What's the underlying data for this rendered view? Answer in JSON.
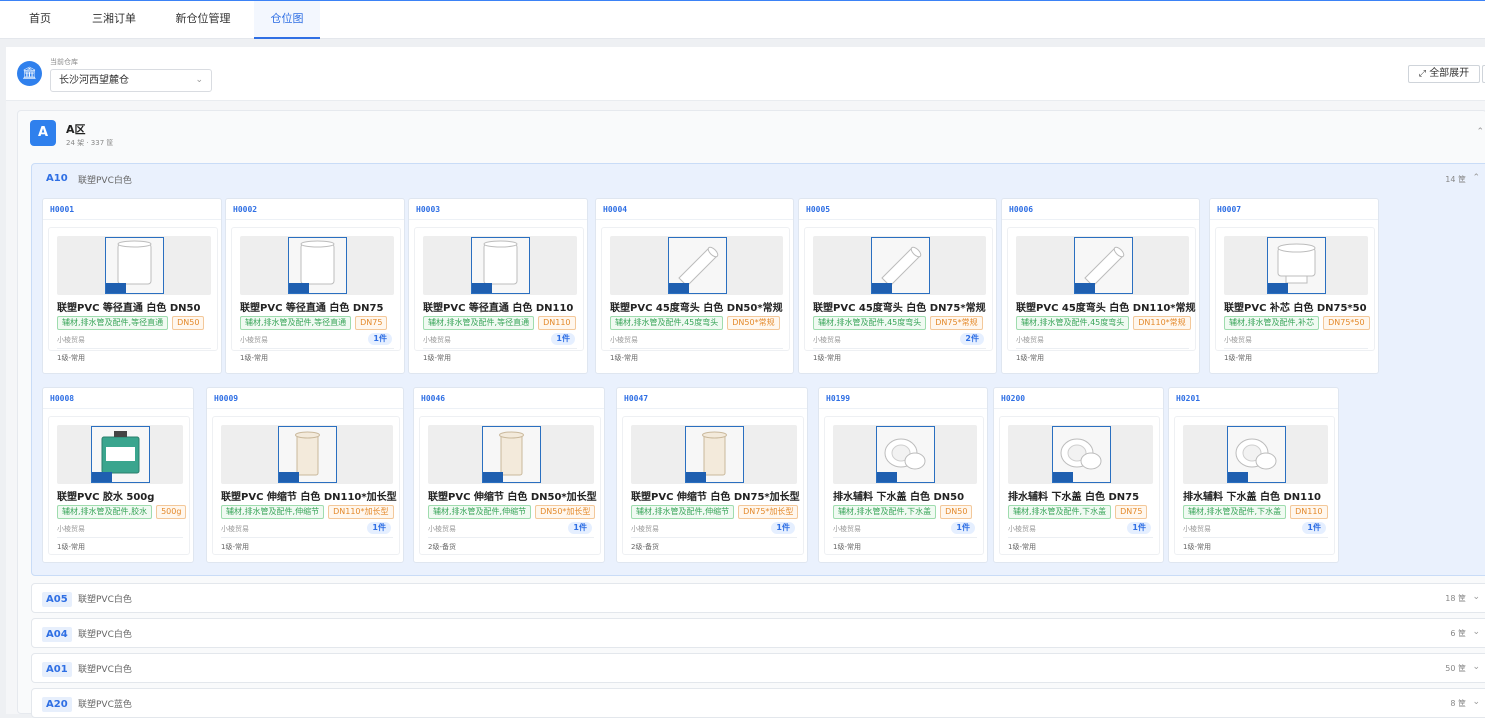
{
  "nav": {
    "tabs": [
      "首页",
      "三湘订单",
      "新仓位管理",
      "仓位图"
    ],
    "active_tab": 3
  },
  "warehouse": {
    "label": "当前仓库",
    "selected": "长沙河西望麓仓",
    "expand_all": "全部展开"
  },
  "zone": {
    "badge": "A",
    "title": "A区",
    "summary": "24 架 · 337 筐",
    "open_shelf": {
      "code": "A10",
      "name": "联塑PVC白色",
      "count": "14 筐"
    },
    "closed_shelves": [
      {
        "code": "A05",
        "name": "联塑PVC白色",
        "count": "18 筐"
      },
      {
        "code": "A04",
        "name": "联塑PVC白色",
        "count": "6 筐"
      },
      {
        "code": "A01",
        "name": "联塑PVC白色",
        "count": "50 筐"
      },
      {
        "code": "A20",
        "name": "联塑PVC蓝色",
        "count": "8 筐"
      }
    ]
  },
  "slots": [
    {
      "code": "H0001",
      "name": "联塑PVC 等径直通 白色 DN50",
      "category": "辅材,排水管及配件,等径直通",
      "spec": "DN50",
      "supplier": "小棱贸易",
      "qty": "",
      "level": "1级-常用",
      "icon": "pipe-coupling-icon"
    },
    {
      "code": "H0002",
      "name": "联塑PVC 等径直通 白色 DN75",
      "category": "辅材,排水管及配件,等径直通",
      "spec": "DN75",
      "supplier": "小棱贸易",
      "qty": "1件",
      "level": "1级-常用",
      "icon": "pipe-coupling-icon"
    },
    {
      "code": "H0003",
      "name": "联塑PVC 等径直通 白色 DN110",
      "category": "辅材,排水管及配件,等径直通",
      "spec": "DN110",
      "supplier": "小棱贸易",
      "qty": "1件",
      "level": "1级-常用",
      "icon": "pipe-coupling-icon"
    },
    {
      "code": "H0004",
      "name": "联塑PVC 45度弯头 白色 DN50*常规",
      "category": "辅材,排水管及配件,45度弯头",
      "spec": "DN50*常规",
      "supplier": "小棱贸易",
      "qty": "",
      "level": "1级-常用",
      "icon": "elbow-45-icon"
    },
    {
      "code": "H0005",
      "name": "联塑PVC 45度弯头 白色 DN75*常规",
      "category": "辅材,排水管及配件,45度弯头",
      "spec": "DN75*常规",
      "supplier": "小棱贸易",
      "qty": "2件",
      "level": "1级-常用",
      "icon": "elbow-45-icon"
    },
    {
      "code": "H0006",
      "name": "联塑PVC 45度弯头 白色 DN110*常规",
      "category": "辅材,排水管及配件,45度弯头",
      "spec": "DN110*常规",
      "supplier": "小棱贸易",
      "qty": "",
      "level": "1级-常用",
      "icon": "elbow-45-icon"
    },
    {
      "code": "H0007",
      "name": "联塑PVC 补芯 白色 DN75*50",
      "category": "辅材,排水管及配件,补芯",
      "spec": "DN75*50",
      "supplier": "小棱贸易",
      "qty": "",
      "level": "1级-常用",
      "icon": "reducer-bushing-icon"
    },
    {
      "code": "H0008",
      "name": "联塑PVC 胶水 500g",
      "category": "辅材,排水管及配件,胶水",
      "spec": "500g",
      "supplier": "小棱贸易",
      "qty": "",
      "level": "1级-常用",
      "icon": "glue-can-icon"
    },
    {
      "code": "H0009",
      "name": "联塑PVC 伸缩节 白色 DN110*加长型",
      "category": "辅材,排水管及配件,伸缩节",
      "spec": "DN110*加长型",
      "supplier": "小棱贸易",
      "qty": "1件",
      "level": "1级-常用",
      "icon": "expansion-joint-icon"
    },
    {
      "code": "H0046",
      "name": "联塑PVC 伸缩节 白色 DN50*加长型",
      "category": "辅材,排水管及配件,伸缩节",
      "spec": "DN50*加长型",
      "supplier": "小棱贸易",
      "qty": "1件",
      "level": "2级-备货",
      "icon": "expansion-joint-icon"
    },
    {
      "code": "H0047",
      "name": "联塑PVC 伸缩节 白色 DN75*加长型",
      "category": "辅材,排水管及配件,伸缩节",
      "spec": "DN75*加长型",
      "supplier": "小棱贸易",
      "qty": "1件",
      "level": "2级-备货",
      "icon": "expansion-joint-icon"
    },
    {
      "code": "H0199",
      "name": "排水辅料 下水盖 白色 DN50",
      "category": "辅材,排水管及配件,下水盖",
      "spec": "DN50",
      "supplier": "小棱贸易",
      "qty": "1件",
      "level": "1级-常用",
      "icon": "drain-cap-icon"
    },
    {
      "code": "H0200",
      "name": "排水辅料 下水盖 白色 DN75",
      "category": "辅材,排水管及配件,下水盖",
      "spec": "DN75",
      "supplier": "小棱贸易",
      "qty": "1件",
      "level": "1级-常用",
      "icon": "drain-cap-icon"
    },
    {
      "code": "H0201",
      "name": "排水辅料 下水盖 白色 DN110",
      "category": "辅材,排水管及配件,下水盖",
      "spec": "DN110",
      "supplier": "小棱贸易",
      "qty": "1件",
      "level": "1级-常用",
      "icon": "drain-cap-icon"
    }
  ],
  "colors": {
    "accent": "#2f80ed",
    "tag_green": "#3aa55a",
    "tag_orange": "#e48a2c"
  }
}
